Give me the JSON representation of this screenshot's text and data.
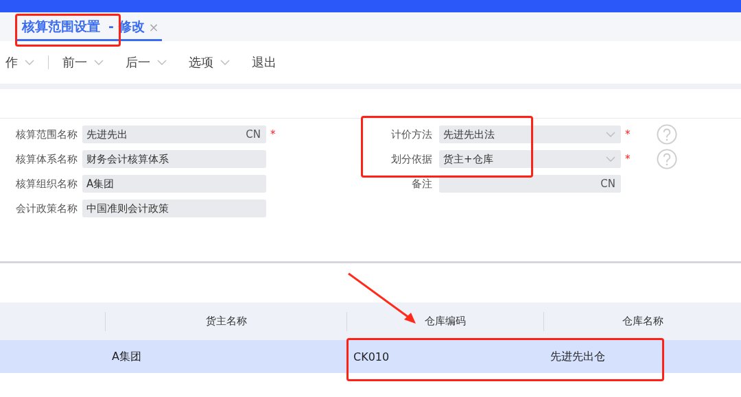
{
  "tab": {
    "title": "核算范围设置",
    "subtitle": "- 修改",
    "close": "×",
    "selected": true
  },
  "toolbar": [
    {
      "label": "作",
      "dropdown": true
    },
    {
      "label": "前一",
      "dropdown": true
    },
    {
      "label": "后一",
      "dropdown": true
    },
    {
      "label": "选项",
      "dropdown": true
    },
    {
      "label": "退出",
      "dropdown": false
    }
  ],
  "form_left": [
    {
      "label": "核算范围名称",
      "value": "先进先出",
      "suffix": "CN",
      "required_mark": "*"
    },
    {
      "label": "核算体系名称",
      "value": "财务会计核算体系"
    },
    {
      "label": "核算组织名称",
      "value": "A集团"
    },
    {
      "label": "会计政策名称",
      "value": "中国准则会计政策"
    }
  ],
  "form_right": [
    {
      "label": "计价方法",
      "value": "先进先出法",
      "kind": "select",
      "required_mark": "*",
      "help": true
    },
    {
      "label": "划分依据",
      "value": "货主+仓库",
      "kind": "select",
      "required_mark": "*",
      "help": true
    },
    {
      "label": "备注",
      "kind": "text",
      "suffix": "CN",
      "help": false
    }
  ],
  "table": {
    "columns": [
      "货主名称",
      "仓库编码",
      "仓库名称"
    ],
    "rows": [
      {
        "selected": true,
        "cells": [
          "A集团",
          "CK010",
          "先进先出仓"
        ]
      }
    ]
  }
}
